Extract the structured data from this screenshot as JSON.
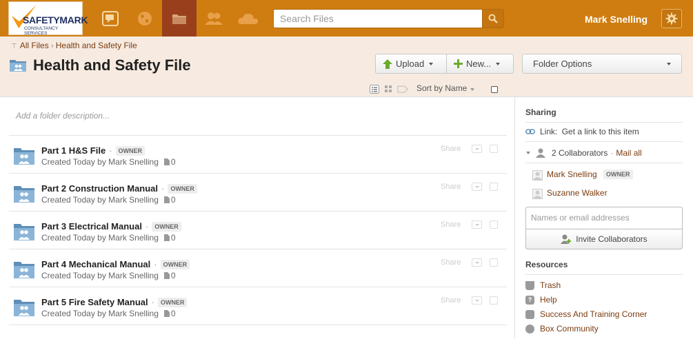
{
  "brand": {
    "name": "SAFETYMARK",
    "tagline": "CONSULTANCY SERVICES"
  },
  "topbar": {
    "search_placeholder": "Search Files",
    "user_name": "Mark Snelling",
    "accent": "#cf7d10",
    "active_nav": "#9a3f1c",
    "nav_items": [
      "updates-icon",
      "globe-icon",
      "folder-icon",
      "people-icon",
      "cloud-icon"
    ]
  },
  "breadcrumb": {
    "root": "All Files",
    "separator": "›",
    "current": "Health and Safety File"
  },
  "page": {
    "title": "Health and Safety File"
  },
  "toolbar": {
    "upload_label": "Upload",
    "new_label": "New...",
    "folder_options_label": "Folder Options",
    "sort_label": "Sort by Name"
  },
  "main": {
    "description_placeholder": "Add a folder description...",
    "share_label": "Share",
    "items": [
      {
        "name": "Part 1 H&S File",
        "badge": "OWNER",
        "meta": "Created Today by Mark Snelling",
        "count": "0"
      },
      {
        "name": "Part 2 Construction Manual",
        "badge": "OWNER",
        "meta": "Created Today by Mark Snelling",
        "count": "0"
      },
      {
        "name": "Part 3 Electrical Manual",
        "badge": "OWNER",
        "meta": "Created Today by Mark Snelling",
        "count": "0"
      },
      {
        "name": "Part 4 Mechanical Manual",
        "badge": "OWNER",
        "meta": "Created Today by Mark Snelling",
        "count": "0"
      },
      {
        "name": "Part 5 Fire Safety Manual",
        "badge": "OWNER",
        "meta": "Created Today by Mark Snelling",
        "count": "0"
      }
    ]
  },
  "sidebar": {
    "sharing_title": "Sharing",
    "link_label": "Link:",
    "link_text": "Get a link to this item",
    "collaborators_label": "2 Collaborators",
    "mail_all": "Mail all",
    "collaborators": [
      {
        "name": "Mark Snelling",
        "badge": "OWNER"
      },
      {
        "name": "Suzanne Walker",
        "badge": ""
      }
    ],
    "invite_placeholder": "Names or email addresses",
    "invite_button": "Invite Collaborators",
    "resources_title": "Resources",
    "resources": [
      {
        "label": "Trash",
        "icon": "trash-icon"
      },
      {
        "label": "Help",
        "icon": "help-icon"
      },
      {
        "label": "Success And Training Corner",
        "icon": "training-icon"
      },
      {
        "label": "Box Community",
        "icon": "community-icon"
      }
    ]
  }
}
